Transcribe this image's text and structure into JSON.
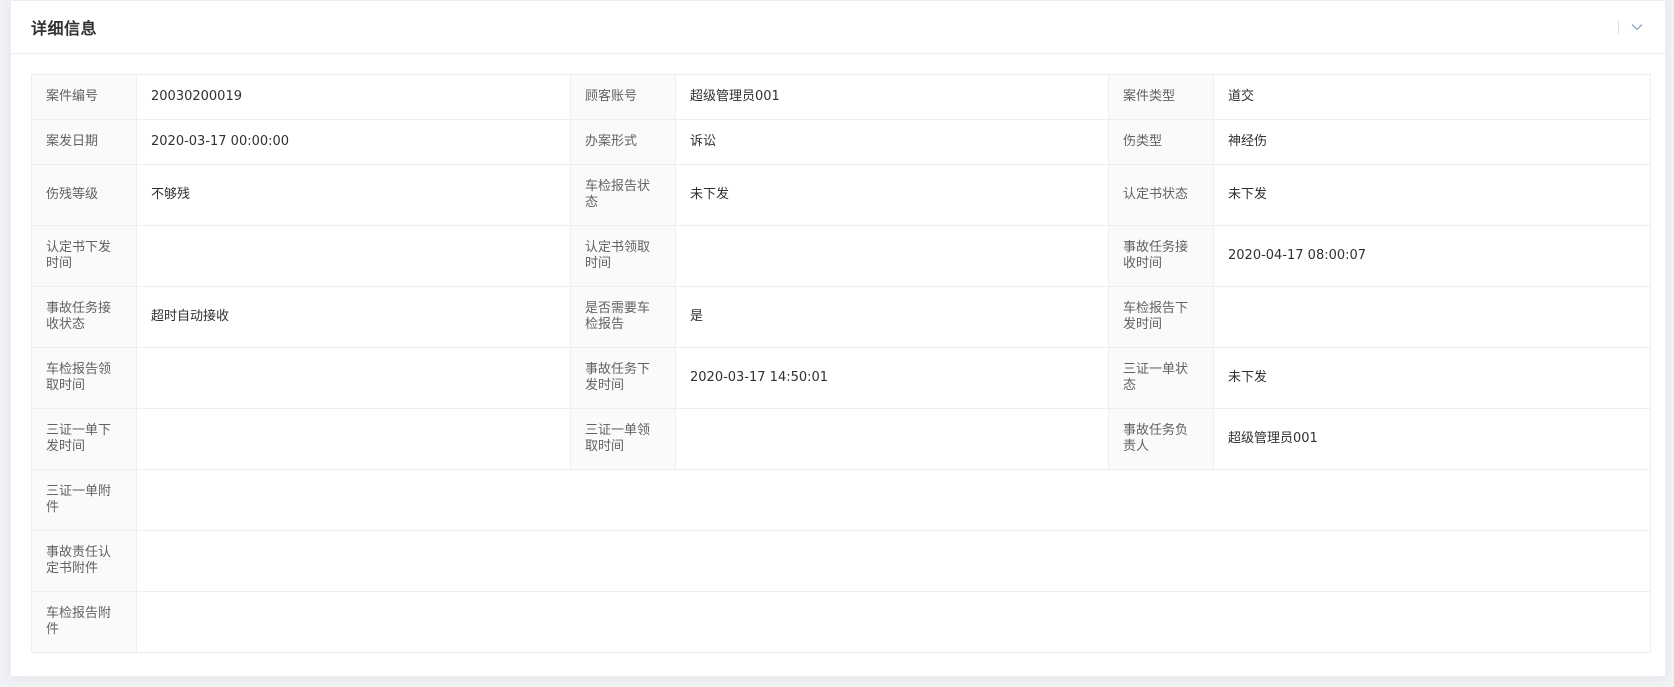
{
  "header": {
    "title": "详细信息",
    "collapse_icon": "chevron-down-icon"
  },
  "rows": [
    [
      {
        "label": "案件编号",
        "value": "20030200019"
      },
      {
        "label": "顾客账号",
        "value": "超级管理员001"
      },
      {
        "label": "案件类型",
        "value": "道交"
      }
    ],
    [
      {
        "label": "案发日期",
        "value": "2020-03-17 00:00:00"
      },
      {
        "label": "办案形式",
        "value": "诉讼"
      },
      {
        "label": "伤类型",
        "value": "神经伤"
      }
    ],
    [
      {
        "label": "伤残等级",
        "value": "不够残"
      },
      {
        "label": "车检报告状态",
        "value": "未下发"
      },
      {
        "label": "认定书状态",
        "value": "未下发"
      }
    ],
    [
      {
        "label": "认定书下发时间",
        "value": ""
      },
      {
        "label": "认定书领取时间",
        "value": ""
      },
      {
        "label": "事故任务接收时间",
        "value": "2020-04-17 08:00:07"
      }
    ],
    [
      {
        "label": "事故任务接收状态",
        "value": "超时自动接收"
      },
      {
        "label": "是否需要车检报告",
        "value": "是"
      },
      {
        "label": "车检报告下发时间",
        "value": ""
      }
    ],
    [
      {
        "label": "车检报告领取时间",
        "value": ""
      },
      {
        "label": "事故任务下发时间",
        "value": "2020-03-17 14:50:01"
      },
      {
        "label": "三证一单状态",
        "value": "未下发"
      }
    ],
    [
      {
        "label": "三证一单下发时间",
        "value": ""
      },
      {
        "label": "三证一单领取时间",
        "value": ""
      },
      {
        "label": "事故任务负责人",
        "value": "超级管理员001"
      }
    ]
  ],
  "attachments": [
    {
      "label": "三证一单附件",
      "value": ""
    },
    {
      "label": "事故责任认定书附件",
      "value": ""
    },
    {
      "label": "车检报告附件",
      "value": ""
    }
  ]
}
